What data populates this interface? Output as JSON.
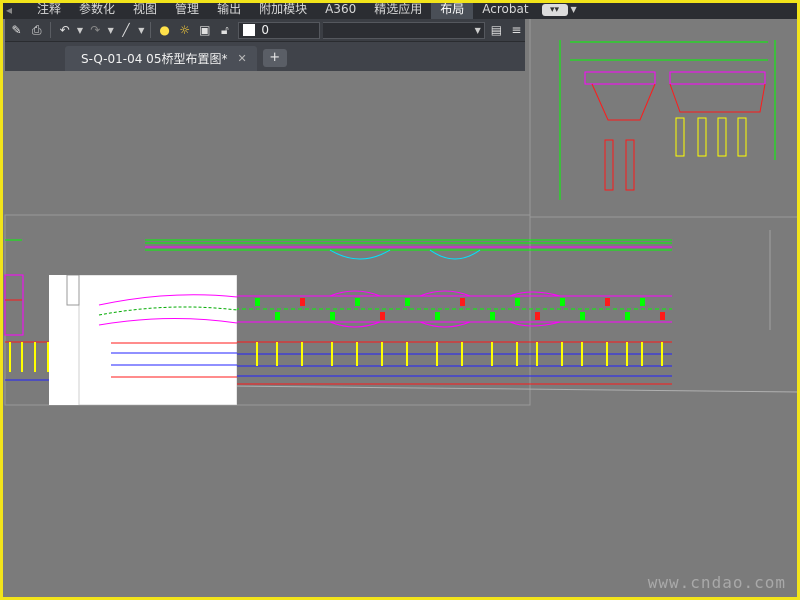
{
  "ribbon": {
    "tabs": [
      "注释",
      "参数化",
      "视图",
      "管理",
      "输出",
      "附加模块",
      "A360",
      "精选应用",
      "布局",
      "Acrobat"
    ],
    "active_tab": "布局"
  },
  "toolbar": {
    "layer_value": "0"
  },
  "document": {
    "tab_title": "S-Q-01-04 05桥型布置图*",
    "close_symbol": "✕",
    "new_tab_symbol": "+"
  },
  "watermark": "www.cndao.com",
  "colors": {
    "canvas_bg": "#7b7b7b",
    "border": "#f2e41a",
    "cad_green": "#00ff00",
    "cad_magenta": "#ff00ff",
    "cad_red": "#ff1a1a",
    "cad_yellow": "#ffff00",
    "cad_blue": "#2020ff",
    "cad_cyan": "#00e5ff"
  }
}
